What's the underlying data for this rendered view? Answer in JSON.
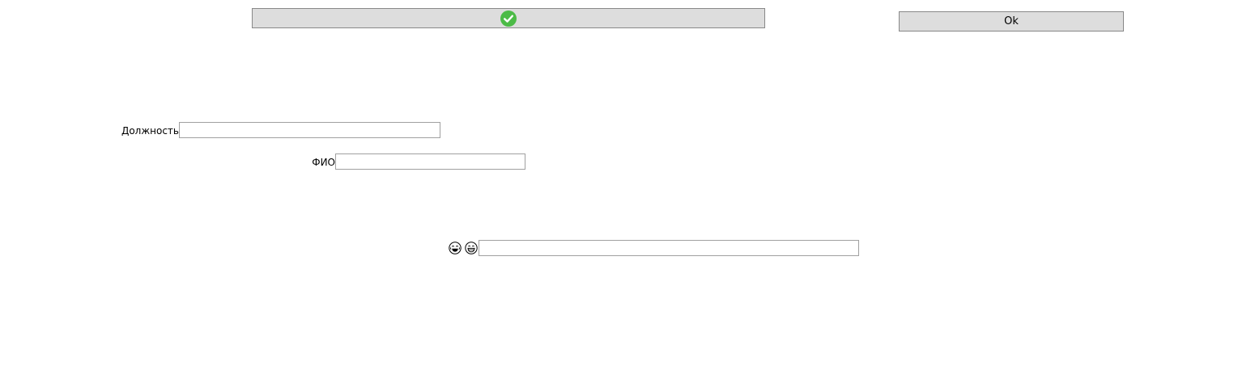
{
  "toolbar": {
    "confirm_icon": "check-circle-icon",
    "confirm_color": "#4cbb47",
    "ok_label": "Ok"
  },
  "form": {
    "position_label": "Должность",
    "position_value": "",
    "fio_label": "ФИО",
    "fio_value": "",
    "emoji_label_icons": [
      "laughing-face-icon",
      "grinning-face-icon"
    ],
    "emoji_value": ""
  }
}
